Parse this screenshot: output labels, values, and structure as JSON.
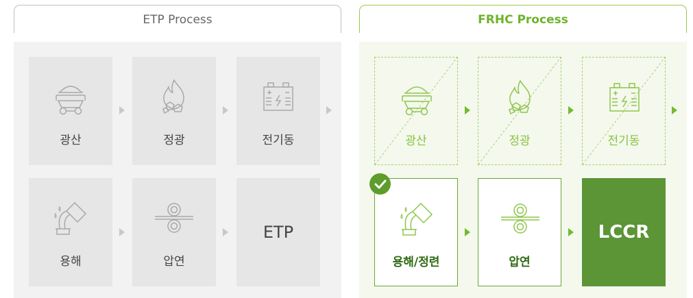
{
  "colors": {
    "etp_gray": "#a8a8a8",
    "frhc_green": "#8fc54c",
    "frhc_dark": "#5b9536"
  },
  "etp": {
    "title": "ETP Process",
    "steps": [
      {
        "label": "광산",
        "icon": "mine-cart-icon"
      },
      {
        "label": "정광",
        "icon": "flame-ore-icon"
      },
      {
        "label": "전기동",
        "icon": "battery-icon"
      },
      {
        "label": "용해",
        "icon": "pouring-icon"
      },
      {
        "label": "압연",
        "icon": "rolling-icon"
      },
      {
        "label": "ETP",
        "icon": ""
      }
    ]
  },
  "frhc": {
    "title": "FRHC Process",
    "steps": [
      {
        "label": "광산",
        "icon": "mine-cart-icon",
        "state": "skipped"
      },
      {
        "label": "정광",
        "icon": "flame-ore-icon",
        "state": "skipped"
      },
      {
        "label": "전기동",
        "icon": "battery-icon",
        "state": "skipped"
      },
      {
        "label": "용해/정련",
        "icon": "pouring-icon",
        "state": "checked"
      },
      {
        "label": "압연",
        "icon": "rolling-icon",
        "state": "active"
      },
      {
        "label": "LCCR",
        "icon": "",
        "state": "result"
      }
    ]
  }
}
